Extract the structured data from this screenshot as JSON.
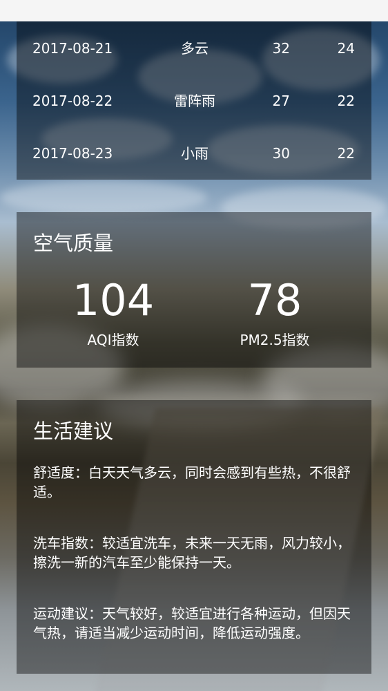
{
  "forecast": [
    {
      "date": "2017-08-21",
      "weather": "多云",
      "max": "32",
      "min": "24"
    },
    {
      "date": "2017-08-22",
      "weather": "雷阵雨",
      "max": "27",
      "min": "22"
    },
    {
      "date": "2017-08-23",
      "weather": "小雨",
      "max": "30",
      "min": "22"
    }
  ],
  "aqi": {
    "title": "空气质量",
    "aqi_value": "104",
    "aqi_label": "AQI指数",
    "pm25_value": "78",
    "pm25_label": "PM2.5指数"
  },
  "suggestion": {
    "title": "生活建议",
    "comfort": "舒适度：白天天气多云，同时会感到有些热，不很舒适。",
    "car_wash": "洗车指数：较适宜洗车，未来一天无雨，风力较小，擦洗一新的汽车至少能保持一天。",
    "sport": "运动建议：天气较好，较适宜进行各种运动，但因天气热，请适当减少运动时间，降低运动强度。"
  },
  "colors": {
    "card_background": "#0000006b",
    "text": "#ffffff",
    "status_bar": "#f5f5f5"
  }
}
